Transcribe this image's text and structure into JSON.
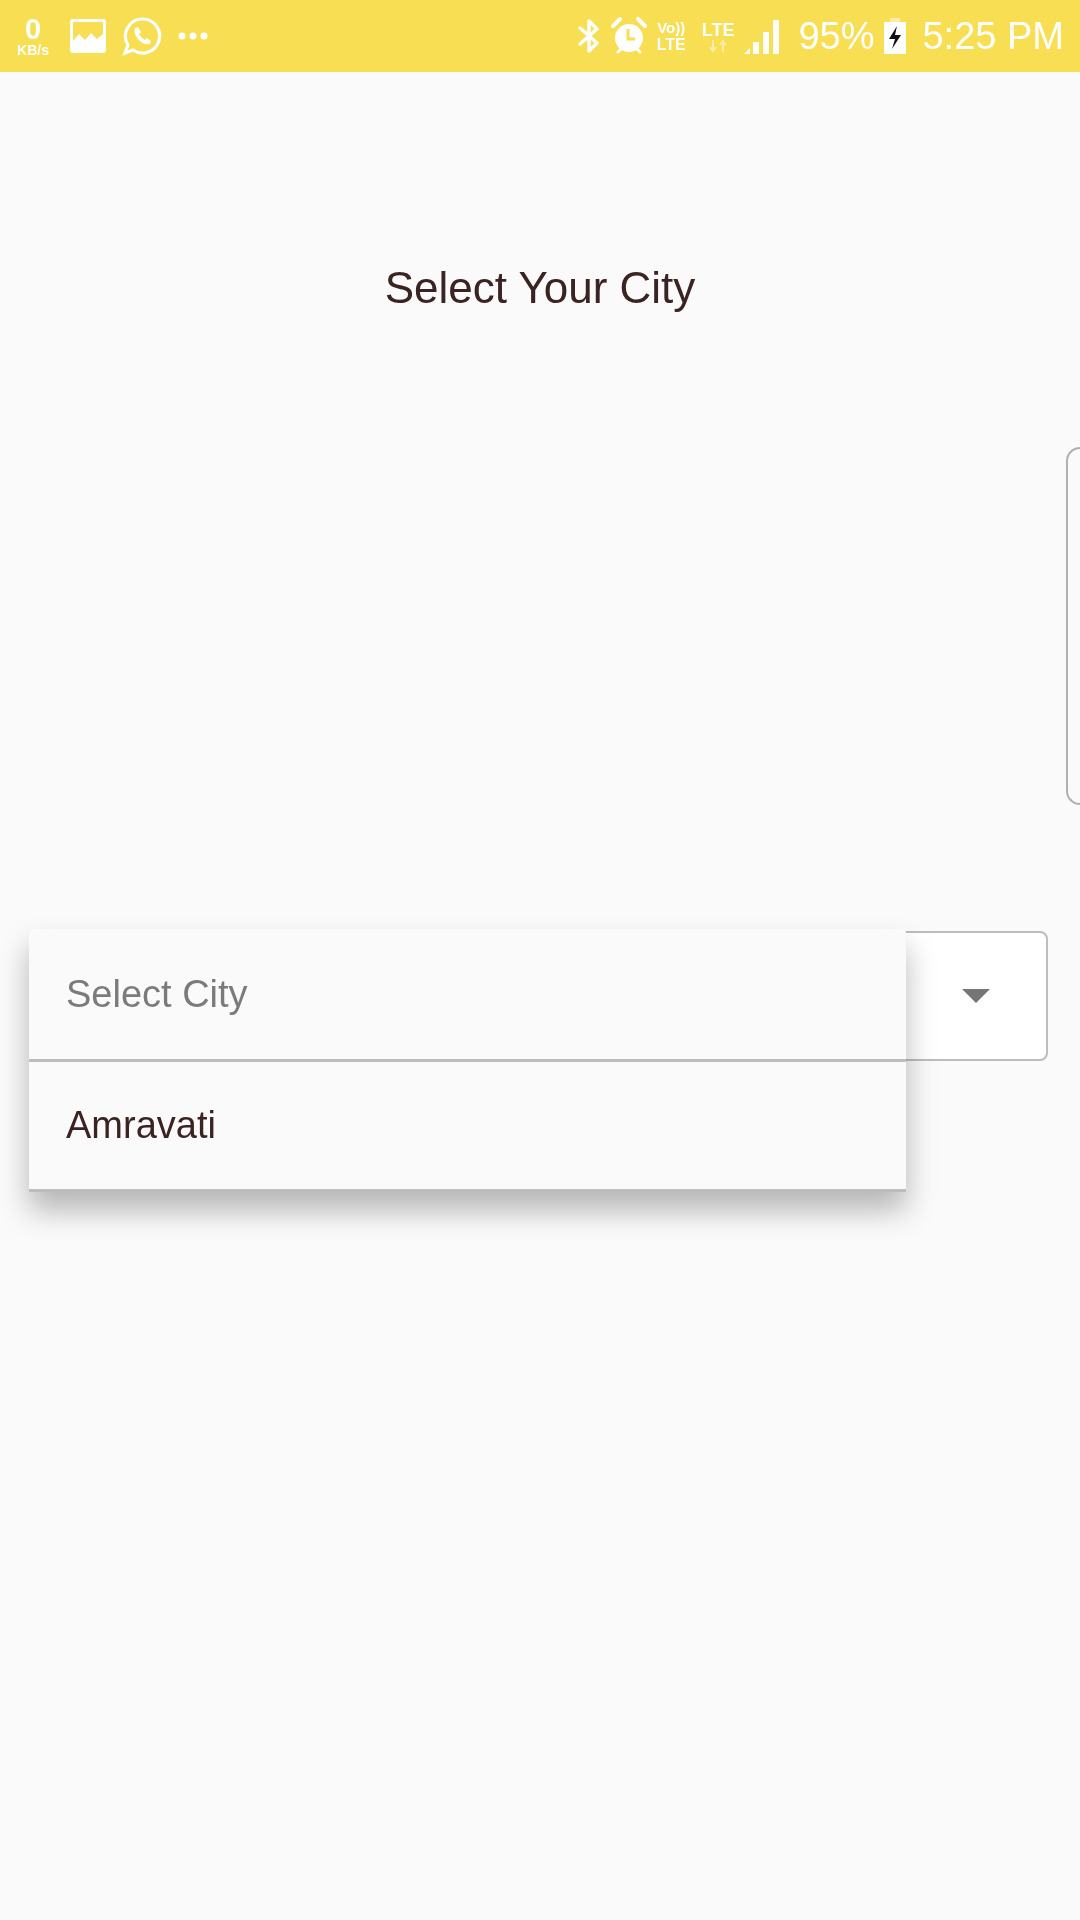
{
  "status_bar": {
    "data_speed": "0",
    "data_speed_unit": "KB/s",
    "volte_top": "Vo))",
    "volte_bottom": "LTE",
    "network_type": "LTE",
    "battery": "95%",
    "time": "5:25 PM"
  },
  "title": "Select Your City",
  "city_dropdown": {
    "expanded": true,
    "options": [
      {
        "label": "Select City",
        "disabled": true
      },
      {
        "label": "Amravati",
        "disabled": false
      }
    ]
  }
}
